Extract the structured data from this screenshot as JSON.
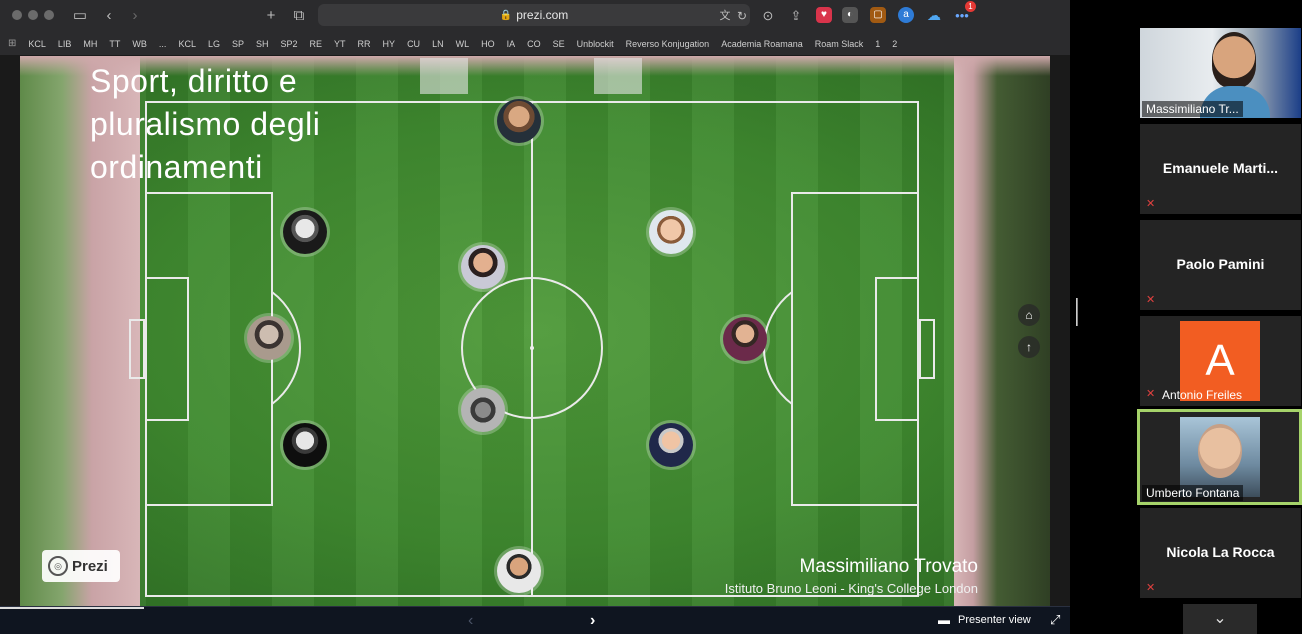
{
  "browser": {
    "url": "prezi.com",
    "notification_count": "1"
  },
  "bookmarks": [
    "KCL",
    "LIB",
    "MH",
    "TT",
    "WB",
    "...",
    "KCL",
    "LG",
    "SP",
    "SH",
    "SP2",
    "RE",
    "YT",
    "RR",
    "HY",
    "CU",
    "LN",
    "WL",
    "HO",
    "IA",
    "CO",
    "SE",
    "Unblockit",
    "Reverso Konjugation",
    "Academia Roamana",
    "Roam Slack",
    "1",
    "2"
  ],
  "slide": {
    "title": "Sport, diritto e pluralismo degli ordinamenti",
    "presenter_name": "Massimiliano Trovato",
    "presenter_institution": "Istituto Bruno Leoni - King's College London",
    "logo_text": "Prezi"
  },
  "bottom_bar": {
    "presenter_view_label": "Presenter view"
  },
  "participants": [
    {
      "name": "Massimiliano Tr...",
      "type": "video"
    },
    {
      "name": "Emanuele  Marti...",
      "type": "name",
      "muted": true
    },
    {
      "name": "Paolo Pamini",
      "type": "name",
      "muted": true
    },
    {
      "name": "Antonio Freiles",
      "type": "avatar",
      "initial": "A",
      "muted": true,
      "avatar_color": "#f25d22"
    },
    {
      "name": "Umberto Fontana",
      "type": "video",
      "active": true
    },
    {
      "name": "Nicola La Rocca",
      "type": "name",
      "muted": true
    }
  ],
  "colors": {
    "active_speaker": "#a6d36a",
    "mute": "#e0413f"
  }
}
